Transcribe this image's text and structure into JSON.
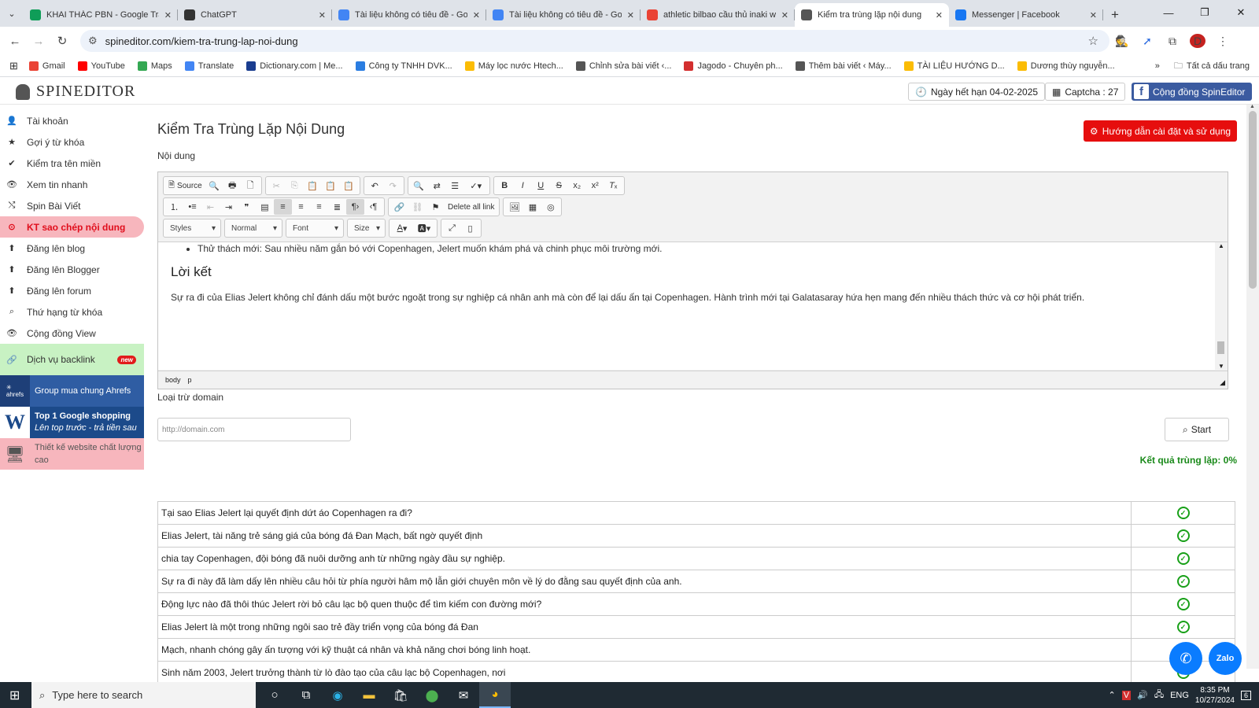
{
  "browser": {
    "tabs": [
      {
        "title": "KHAI THÁC PBN - Google Trang tính",
        "icon": "sheets-icon",
        "color": "#0f9d58",
        "active": false
      },
      {
        "title": "ChatGPT",
        "icon": "chatgpt-icon",
        "color": "#333333",
        "active": false
      },
      {
        "title": "Tài liệu không có tiêu đề - Google Tài liệu",
        "icon": "docs-icon",
        "color": "#4285f4",
        "active": false
      },
      {
        "title": "Tài liệu không có tiêu đề - Google Tài liệu",
        "icon": "docs-icon",
        "color": "#4285f4",
        "active": false
      },
      {
        "title": "athletic bilbao cầu thủ inaki williams",
        "icon": "google-icon",
        "color": "#ea4335",
        "active": false
      },
      {
        "title": "Kiểm tra trùng lặp nội dung",
        "icon": "spineditor-icon",
        "color": "#555555",
        "active": true
      },
      {
        "title": "Messenger | Facebook",
        "icon": "facebook-icon",
        "color": "#1877f2",
        "active": false
      }
    ],
    "url": "spineditor.com/kiem-tra-trung-lap-noi-dung",
    "profile_letter": "D",
    "bookmarks": [
      {
        "label": "Gmail",
        "color": "#ea4335"
      },
      {
        "label": "YouTube",
        "color": "#ff0000"
      },
      {
        "label": "Maps",
        "color": "#34a853"
      },
      {
        "label": "Translate",
        "color": "#4285f4"
      },
      {
        "label": "Dictionary.com | Me...",
        "color": "#1a3d8f"
      },
      {
        "label": "Công ty TNHH DVK...",
        "color": "#2a7de1"
      },
      {
        "label": "Máy lọc nước Htech...",
        "color": "#fbbc04"
      },
      {
        "label": "Chỉnh sửa bài viết ‹...",
        "color": "#555555"
      },
      {
        "label": "Jagodo - Chuyên ph...",
        "color": "#d32f2f"
      },
      {
        "label": "Thêm bài viết ‹ Máy...",
        "color": "#555555"
      },
      {
        "label": "TÀI LIỆU HƯỚNG D...",
        "color": "#fbbc04"
      },
      {
        "label": "Dương thùy nguyễn...",
        "color": "#fbbc04"
      }
    ],
    "all_bookmarks": "Tất cả dấu trang"
  },
  "header": {
    "logo": "SPINEDITOR",
    "expiry": "Ngày hết hạn 04-02-2025",
    "captcha": "Captcha : 27",
    "community": "Cộng đồng SpinEditor"
  },
  "sidebar": {
    "items": [
      {
        "label": "Tài khoản",
        "icon": "user-icon",
        "glyph": "👤"
      },
      {
        "label": "Gợi ý từ khóa",
        "icon": "star-icon",
        "glyph": "★"
      },
      {
        "label": "Kiểm tra tên miền",
        "icon": "check-icon",
        "glyph": "✔"
      },
      {
        "label": "Xem tin nhanh",
        "icon": "eye-icon",
        "glyph": "👁"
      },
      {
        "label": "Spin Bài Viết",
        "icon": "shuffle-icon",
        "glyph": "⤭"
      },
      {
        "label": "KT sao chép nội dung",
        "icon": "copy-check-icon",
        "glyph": "⊙",
        "active": true
      },
      {
        "label": "Đăng lên blog",
        "icon": "upload-icon",
        "glyph": "⬆"
      },
      {
        "label": "Đăng lên Blogger",
        "icon": "upload-icon",
        "glyph": "⬆"
      },
      {
        "label": "Đăng lên forum",
        "icon": "upload-icon",
        "glyph": "⬆"
      },
      {
        "label": "Thứ hạng từ khóa",
        "icon": "search-icon",
        "glyph": "⌕"
      },
      {
        "label": "Cộng đồng View",
        "icon": "eye-icon",
        "glyph": "👁"
      }
    ],
    "backlink": {
      "label": "Dịch vụ backlink",
      "badge": "new"
    },
    "ads": [
      {
        "label": "Group mua chung Ahrefs",
        "bg": "#2f5da3",
        "logo": "ahrefs"
      },
      {
        "label": "Top 1 Google shopping",
        "sub": "Lên top trước - trả tiền sau",
        "bg": "#1c4a8a"
      },
      {
        "label": "Thiết kế website chất lượng cao",
        "bg": "#f7b6bd"
      }
    ]
  },
  "main": {
    "title": "Kiểm Tra Trùng Lặp Nội Dung",
    "help_button": "Hướng dẫn cài đặt và sử dụng",
    "content_label": "Nội dung",
    "toolbar": {
      "source": "Source",
      "delete_links": "Delete all link",
      "styles": "Styles",
      "format": "Normal",
      "font": "Font",
      "size": "Size"
    },
    "editor": {
      "bullet": "Thử thách mới: Sau nhiều năm gắn bó với Copenhagen, Jelert muốn khám phá và chinh phục môi trường mới.",
      "heading": "Lời kết",
      "paragraph": "Sự ra đi của Elias Jelert không chỉ đánh dấu một bước ngoặt trong sự nghiệp cá nhân anh mà còn để lại dấu ấn tại Copenhagen. Hành trình mới tại Galatasaray hứa hẹn mang đến nhiều thách thức và cơ hội phát triển.",
      "path": [
        "body",
        "p"
      ]
    },
    "exclude_label": "Loại trừ domain",
    "domain_placeholder": "http://domain.com",
    "start_button": "Start",
    "result": "Kết quả trùng lặp: 0%",
    "rows": [
      "Tại sao Elias Jelert  lại quyết định dứt áo Copenhagen ra đi?",
      "Elias Jelert, tài năng trẻ sáng giá của bóng đá Đan Mạch, bất ngờ quyết định",
      "chia tay Copenhagen, đội bóng đã nuôi dưỡng anh từ những ngày đầu sự nghiệp.",
      "Sự ra đi này đã làm dấy lên nhiều câu hỏi từ phía người hâm mộ lẫn giới chuyên môn về lý do đằng sau quyết định của anh.",
      "Động lực nào đã thôi thúc Jelert rời bỏ câu lạc bộ quen thuộc để tìm kiếm con đường mới?",
      "Elias Jelert là một trong những ngôi sao trẻ đầy triển vọng của bóng đá Đan",
      "Mạch, nhanh chóng gây ấn tượng với kỹ thuật cá nhân và khả năng chơi bóng linh hoạt.",
      "Sinh năm 2003, Jelert trưởng thành từ lò đào tạo của câu lạc bộ Copenhagen, nơi"
    ]
  },
  "taskbar": {
    "search_placeholder": "Type here to search",
    "language": "ENG",
    "time": "8:35 PM",
    "date": "10/27/2024",
    "notifications": "6"
  }
}
